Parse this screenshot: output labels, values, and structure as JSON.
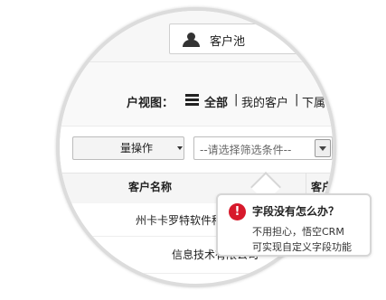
{
  "customer_pool": {
    "label": "客户池",
    "icon": "user-icon"
  },
  "view_bar": {
    "title": "户视图：",
    "menu_icon": "menu-icon",
    "all": "全部",
    "sep1": "|",
    "mine": "我的客户",
    "sep2": "|",
    "subordinate": "下属客"
  },
  "filter_bar": {
    "bulk_label": "量操作",
    "filter_placeholder": "--请选择筛选条件--"
  },
  "table": {
    "headers": {
      "name": "客户名称",
      "next": "客户"
    },
    "rows": [
      {
        "name": "州卡卡罗特软件科技有限公司"
      },
      {
        "name": "信息技术有限公司"
      }
    ]
  },
  "callout": {
    "icon": "exclamation-icon",
    "icon_glyph": "!",
    "title": "字段没有怎么办？",
    "line1": "不用担心，悟空CRM",
    "line2": "可实现自定义字段功能"
  },
  "colors": {
    "accent_red": "#d7192b",
    "lens_border": "#dcdcdc"
  }
}
